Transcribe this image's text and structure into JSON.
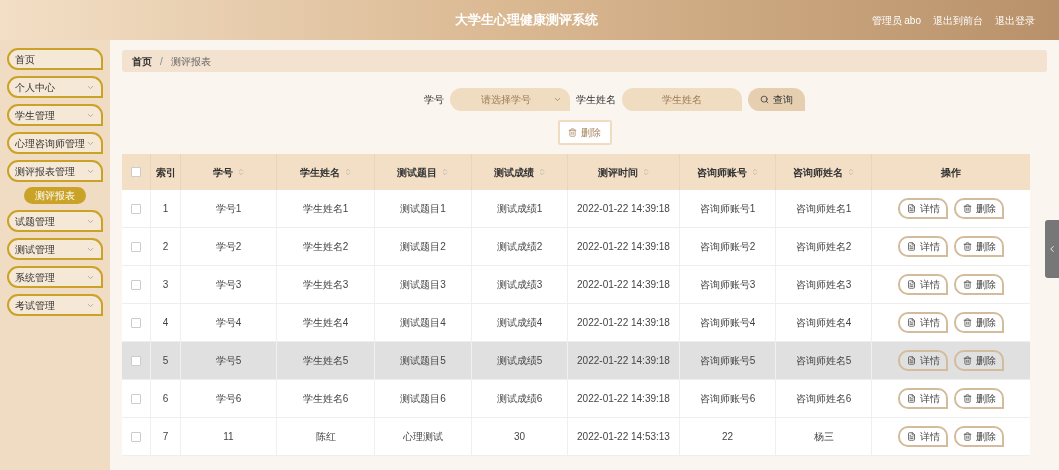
{
  "header": {
    "title": "大学生心理健康测评系统",
    "links": [
      "管理员 abo",
      "退出到前台",
      "退出登录"
    ]
  },
  "sidebar": {
    "items": [
      {
        "label": "首页",
        "expandable": false,
        "selected": false
      },
      {
        "label": "个人中心",
        "expandable": true,
        "selected": false
      },
      {
        "label": "学生管理",
        "expandable": true,
        "selected": false
      },
      {
        "label": "心理咨询师管理",
        "expandable": true,
        "selected": false
      },
      {
        "label": "测评报表管理",
        "expandable": true,
        "selected": false,
        "children": [
          {
            "label": "测评报表",
            "selected": true
          }
        ]
      },
      {
        "label": "试题管理",
        "expandable": true,
        "selected": false
      },
      {
        "label": "测试管理",
        "expandable": true,
        "selected": false
      },
      {
        "label": "系统管理",
        "expandable": true,
        "selected": false
      },
      {
        "label": "考试管理",
        "expandable": true,
        "selected": false
      }
    ]
  },
  "breadcrumb": {
    "items": [
      "首页",
      "测评报表"
    ],
    "separator": "/"
  },
  "search": {
    "fields": [
      {
        "label": "学号",
        "placeholder": "请选择学号",
        "kind": "select"
      },
      {
        "label": "学生姓名",
        "placeholder": "学生姓名",
        "kind": "text"
      }
    ],
    "button": "查询"
  },
  "delete_button": "删除",
  "table": {
    "select_all": {
      "checked": false
    },
    "columns": [
      "索引",
      "学号",
      "学生姓名",
      "测试题目",
      "测试成绩",
      "测评时间",
      "咨询师账号",
      "咨询师姓名",
      "操作"
    ],
    "rows": [
      {
        "checked": false,
        "hovered": false,
        "cells": [
          "1",
          "学号1",
          "学生姓名1",
          "测试题目1",
          "测试成绩1",
          "2022-01-22 14:39:18",
          "咨询师账号1",
          "咨询师姓名1"
        ],
        "actions": [
          "详情",
          "删除"
        ]
      },
      {
        "checked": false,
        "hovered": false,
        "cells": [
          "2",
          "学号2",
          "学生姓名2",
          "测试题目2",
          "测试成绩2",
          "2022-01-22 14:39:18",
          "咨询师账号2",
          "咨询师姓名2"
        ],
        "actions": [
          "详情",
          "删除"
        ]
      },
      {
        "checked": false,
        "hovered": false,
        "cells": [
          "3",
          "学号3",
          "学生姓名3",
          "测试题目3",
          "测试成绩3",
          "2022-01-22 14:39:18",
          "咨询师账号3",
          "咨询师姓名3"
        ],
        "actions": [
          "详情",
          "删除"
        ]
      },
      {
        "checked": false,
        "hovered": false,
        "cells": [
          "4",
          "学号4",
          "学生姓名4",
          "测试题目4",
          "测试成绩4",
          "2022-01-22 14:39:18",
          "咨询师账号4",
          "咨询师姓名4"
        ],
        "actions": [
          "详情",
          "删除"
        ]
      },
      {
        "checked": false,
        "hovered": true,
        "cells": [
          "5",
          "学号5",
          "学生姓名5",
          "测试题目5",
          "测试成绩5",
          "2022-01-22 14:39:18",
          "咨询师账号5",
          "咨询师姓名5"
        ],
        "actions": [
          "详情",
          "删除"
        ]
      },
      {
        "checked": false,
        "hovered": false,
        "cells": [
          "6",
          "学号6",
          "学生姓名6",
          "测试题目6",
          "测试成绩6",
          "2022-01-22 14:39:18",
          "咨询师账号6",
          "咨询师姓名6"
        ],
        "actions": [
          "详情",
          "删除"
        ]
      },
      {
        "checked": false,
        "hovered": false,
        "cells": [
          "7",
          "11",
          "陈红",
          "心理测试",
          "30",
          "2022-01-22 14:53:13",
          "22",
          "杨三"
        ],
        "actions": [
          "详情",
          "删除"
        ]
      }
    ]
  }
}
